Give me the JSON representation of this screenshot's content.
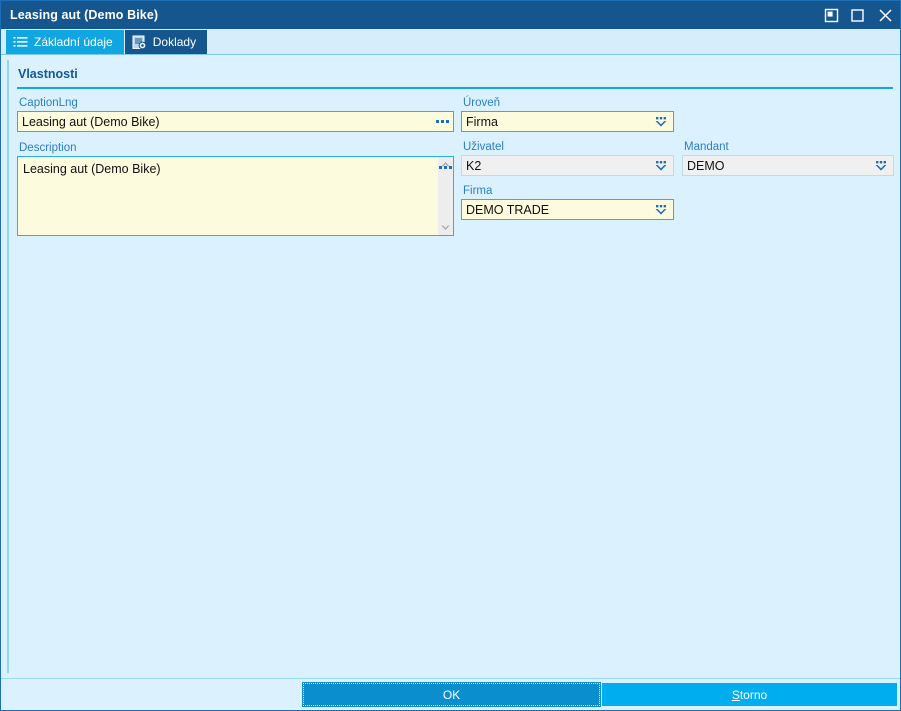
{
  "window": {
    "title": "Leasing aut (Demo Bike)",
    "controls": [
      {
        "name": "restore-button",
        "icon": "restore-icon"
      },
      {
        "name": "maximize-button",
        "icon": "maximize-icon"
      },
      {
        "name": "close-button",
        "icon": "close-icon"
      }
    ]
  },
  "tabs": [
    {
      "label": "Základní údaje",
      "icon": "list-icon",
      "active": true
    },
    {
      "label": "Doklady",
      "icon": "document-icon",
      "active": false
    }
  ],
  "panel": {
    "title": "Vlastnosti"
  },
  "fields": {
    "caption_lng": {
      "label": "CaptionLng",
      "value": "Leasing aut (Demo Bike)",
      "placeholder": ""
    },
    "description": {
      "label": "Description",
      "value": "Leasing aut (Demo Bike)",
      "placeholder": ""
    },
    "uroven": {
      "label": "Úroveň",
      "value": "Firma"
    },
    "uzivatel": {
      "label": "Uživatel",
      "value": "K2"
    },
    "mandant": {
      "label": "Mandant",
      "value": "DEMO"
    },
    "firma": {
      "label": "Firma",
      "value": "DEMO TRADE"
    }
  },
  "footer": {
    "ok_label": "OK",
    "storno_accel": "S",
    "storno_rest": "torno"
  },
  "colors": {
    "titlebar": "#15568f",
    "tab_active": "#10a6e2",
    "tab_inactive": "#15568f",
    "accent": "#16a5e0",
    "body_bg": "#dbf1fd",
    "field_bg": "#fdfbdd",
    "field_readonly_bg": "#f0f0f0",
    "ok_button": "#0b8ecd",
    "storno_button": "#00aeef",
    "label_text": "#2b7fc4"
  }
}
